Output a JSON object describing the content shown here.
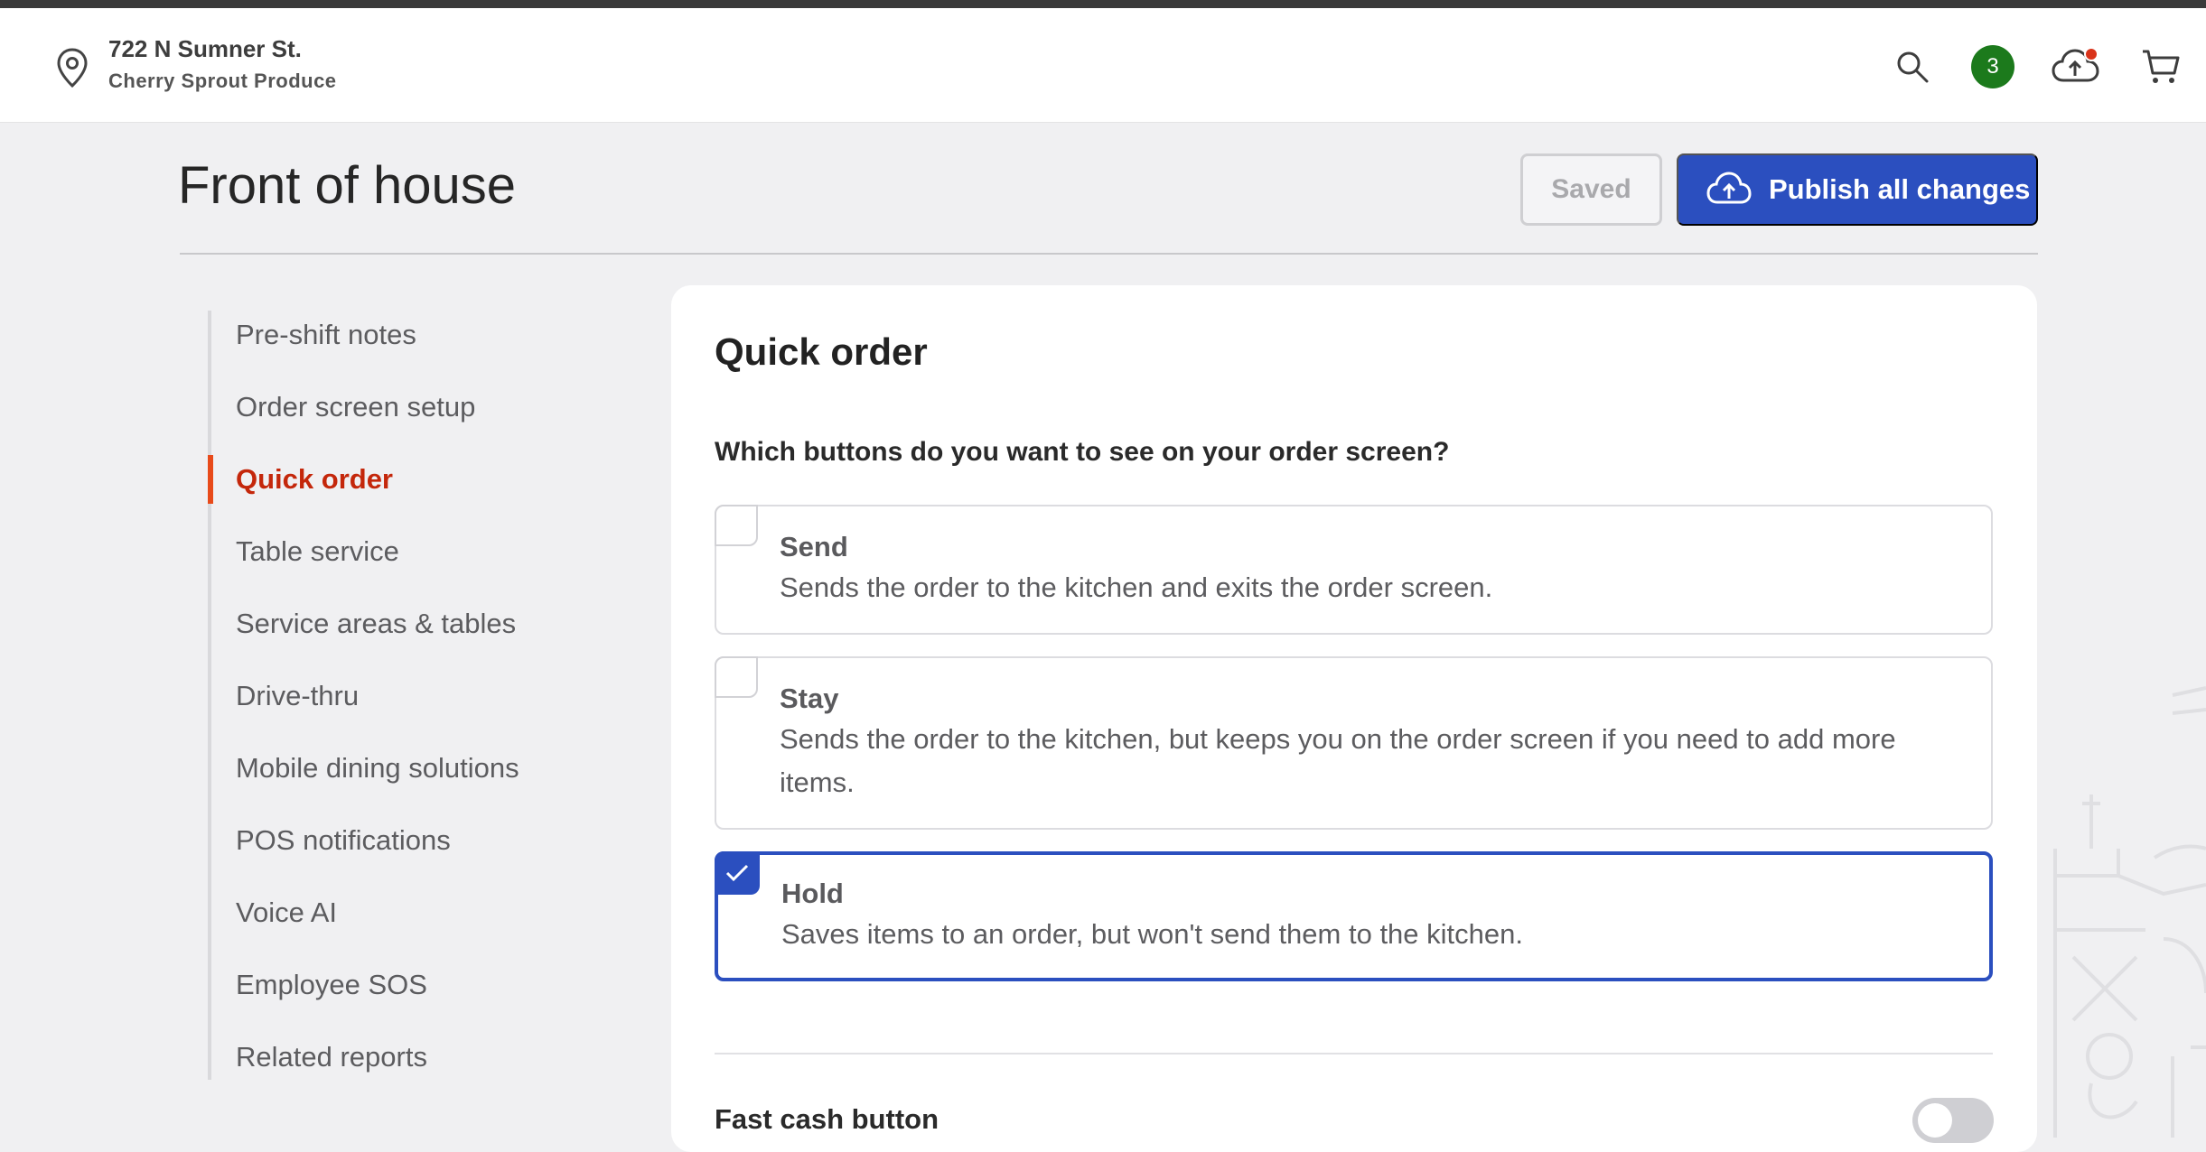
{
  "location": {
    "street": "722 N Sumner St.",
    "name": "Cherry Sprout Produce"
  },
  "header": {
    "notification_count": "3"
  },
  "page": {
    "title": "Front of house",
    "saved_label": "Saved",
    "publish_label": "Publish all changes"
  },
  "sidebar": {
    "items": [
      {
        "label": "Pre-shift notes"
      },
      {
        "label": "Order screen setup"
      },
      {
        "label": "Quick order"
      },
      {
        "label": "Table service"
      },
      {
        "label": "Service areas & tables"
      },
      {
        "label": "Drive-thru"
      },
      {
        "label": "Mobile dining solutions"
      },
      {
        "label": "POS notifications"
      },
      {
        "label": "Voice AI"
      },
      {
        "label": "Employee SOS"
      },
      {
        "label": "Related reports"
      }
    ],
    "active": "Quick order"
  },
  "panel": {
    "title": "Quick order",
    "question": "Which buttons do you want to see on your order screen?",
    "options": [
      {
        "title": "Send",
        "description": "Sends the order to the kitchen and exits the order screen.",
        "checked": false
      },
      {
        "title": "Stay",
        "description": "Sends the order to the kitchen, but keeps you on the order screen if you need to add more items.",
        "checked": false
      },
      {
        "title": "Hold",
        "description": "Saves items to an order, but won't send them to the kitchen.",
        "checked": true
      }
    ],
    "fast_cash": {
      "label": "Fast cash button",
      "enabled": false
    }
  },
  "colors": {
    "accent": "#2b4fbf",
    "active_nav": "#c4270b",
    "badge": "#1c7a1c",
    "alert_dot": "#d9331a"
  }
}
